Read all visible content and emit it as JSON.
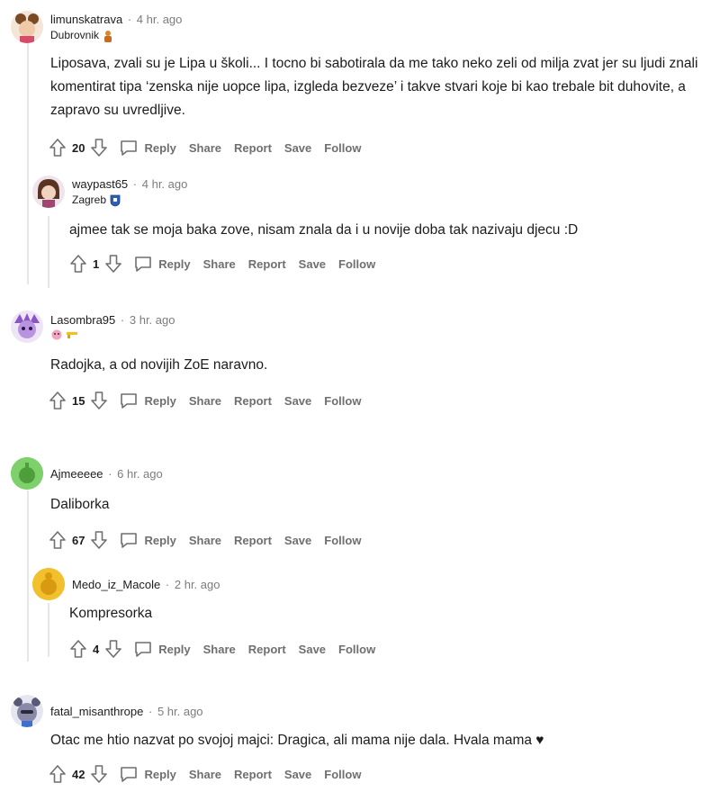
{
  "comments": [
    {
      "user": "limunskatrava",
      "time": "4 hr. ago",
      "flair": "Dubrovnik",
      "body": "Liposava, zvali su je Lipa u školi... I tocno bi sabotirala da me tako neko zeli od milja zvat jer su ljudi znali komentirat tipa ‘zenska nije uopce lipa, izgleda bezveze’ i takve stvari koje bi kao trebale bit duhovite, a zapravo su uvredljive.",
      "votes": "20"
    },
    {
      "user": "waypast65",
      "time": "4 hr. ago",
      "flair": "Zagreb",
      "body": "ajmee tak se moja baka zove, nisam znala da i u novije doba tak nazivaju djecu :D",
      "votes": "1"
    },
    {
      "user": "Lasombra95",
      "time": "3 hr. ago",
      "flair": "",
      "body": "Radojka, a od novijih ZoE naravno.",
      "votes": "15"
    },
    {
      "user": "Ajmeeeee",
      "time": "6 hr. ago",
      "flair": "",
      "body": "Daliborka",
      "votes": "67"
    },
    {
      "user": "Medo_iz_Macole",
      "time": "2 hr. ago",
      "flair": "",
      "body": "Kompresorka",
      "votes": "4"
    },
    {
      "user": "fatal_misanthrope",
      "time": "5 hr. ago",
      "flair": "",
      "body": "Otac me htio nazvat po svojoj majci: Dragica, ali mama nije dala. Hvala mama ♥",
      "votes": "42"
    }
  ],
  "actions": {
    "reply": "Reply",
    "share": "Share",
    "report": "Report",
    "save": "Save",
    "follow": "Follow"
  },
  "separator": "·",
  "colors": {
    "text": "#1c1c1c",
    "meta": "#7c7c7c",
    "action": "#6f6f6f",
    "thread_line": "#e6e6e6"
  }
}
